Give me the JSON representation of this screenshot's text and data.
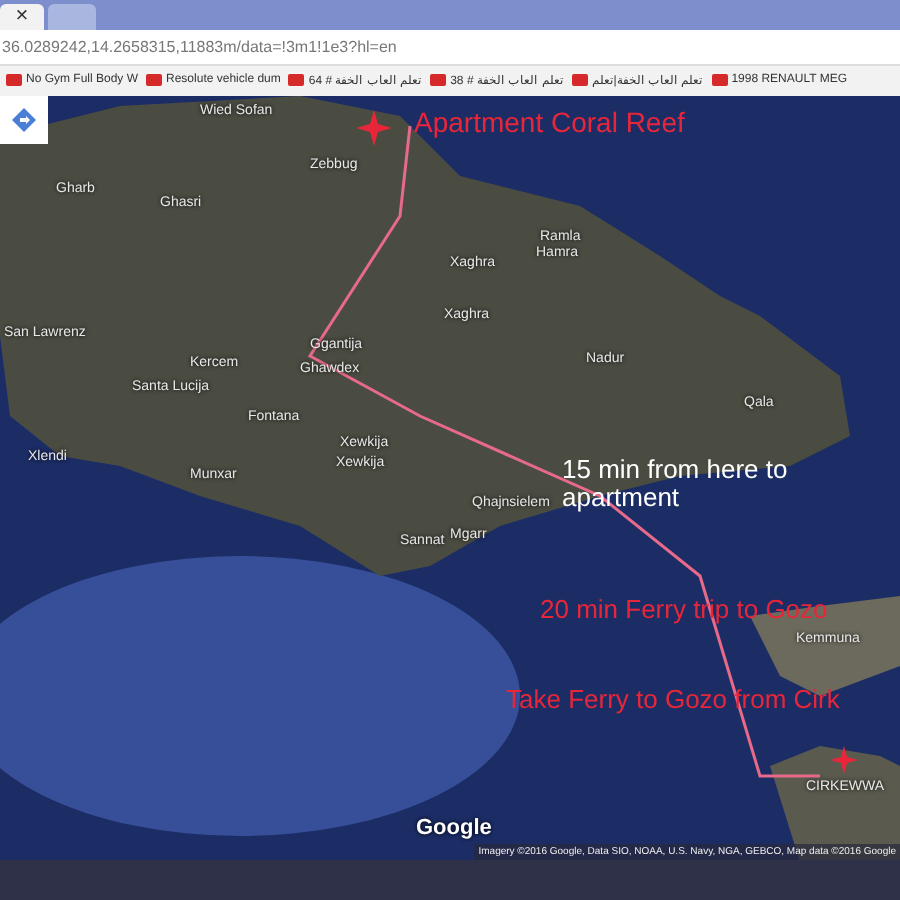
{
  "browser": {
    "tabs": [
      {
        "selected": true,
        "close": "×"
      },
      {
        "selected": false
      }
    ],
    "address": "36.0289242,14.2658315,11883m/data=!3m1!1e3?hl=en",
    "bookmarks": [
      {
        "label": "No Gym Full Body W"
      },
      {
        "label": "Resolute vehicle dum"
      },
      {
        "label": "تعلم العاب الخفة # 64"
      },
      {
        "label": "تعلم العاب الخفة # 38"
      },
      {
        "label": "تعلم العاب الخفة|تعلم"
      },
      {
        "label": "1998 RENAULT MEG"
      }
    ]
  },
  "map": {
    "place_labels": [
      "Wied Sofan",
      "Zebbug",
      "Gharb",
      "Ghasri",
      "Ramla",
      "Hamra",
      "Xaghra",
      "San Lawrenz",
      "Xaghra",
      "Ggantija",
      "Kercem",
      "Ghawdex",
      "Santa Lucija",
      "Nadur",
      "Fontana",
      "Qala",
      "Xewkija",
      "Xlendi",
      "Munxar",
      "Xewkija",
      "Qhajnsielem",
      "Sannat",
      "Mgarr",
      "Kemmuna",
      "CIRKEWWA"
    ],
    "annotations": [
      {
        "text": "Apartment Coral Reef",
        "color": "#e8263a"
      },
      {
        "text": "15 min from here to apartment",
        "color": "#ffffff"
      },
      {
        "text": "20 min Ferry trip to Gozo",
        "color": "#e8263a"
      },
      {
        "text": "Take Ferry to Gozo from Cirk",
        "color": "#e8263a"
      }
    ],
    "logo": "Google",
    "attribution": "Imagery ©2016 Google, Data SIO, NOAA, U.S. Navy, NGA, GEBCO, Map data ©2016 Google"
  }
}
